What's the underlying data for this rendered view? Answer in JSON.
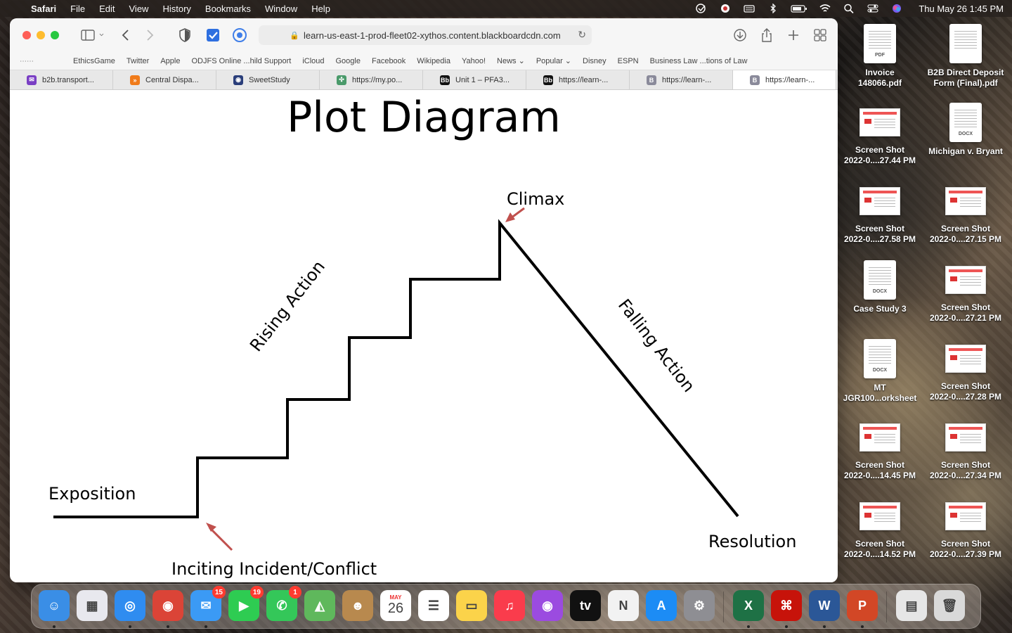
{
  "menubar": {
    "app_name": "Safari",
    "items": [
      "File",
      "Edit",
      "View",
      "History",
      "Bookmarks",
      "Window",
      "Help"
    ],
    "clock": "Thu May 26  1:45 PM"
  },
  "toolbar": {
    "url": "learn-us-east-1-prod-fleet02-xythos.content.blackboardcdn.com"
  },
  "favorites": [
    "EthicsGame",
    "Twitter",
    "Apple",
    "ODJFS Online ...hild Support",
    "iCloud",
    "Google",
    "Facebook",
    "Wikipedia",
    "Yahoo!",
    "News ⌄",
    "Popular ⌄",
    "Disney",
    "ESPN",
    "Business Law ...tions of Law"
  ],
  "tabs": [
    {
      "label": "b2b.transport...",
      "color": "#7a3fc4",
      "glyph": "✉"
    },
    {
      "label": "Central Dispa...",
      "color": "#f07b1a",
      "glyph": "»"
    },
    {
      "label": "SweetStudy",
      "color": "#2a3e7a",
      "glyph": "◉"
    },
    {
      "label": "https://my.po...",
      "color": "#4a9a6a",
      "glyph": "✣"
    },
    {
      "label": "Unit 1 – PFA3...",
      "color": "#111111",
      "glyph": "Bb"
    },
    {
      "label": "https://learn-...",
      "color": "#111111",
      "glyph": "Bb"
    },
    {
      "label": "https://learn-...",
      "color": "#8a8a9a",
      "glyph": "B"
    },
    {
      "label": "https://learn-...",
      "color": "#8a8a9a",
      "glyph": "B"
    }
  ],
  "diagram": {
    "title": "Plot Diagram",
    "labels": {
      "exposition": "Exposition",
      "inciting": "Inciting Incident/Conflict",
      "rising": "Rising Action",
      "climax": "Climax",
      "falling": "Falling Action",
      "resolution": "Resolution"
    },
    "arrow_color": "#c0504d"
  },
  "desktop": [
    {
      "kind": "doc",
      "tag": "PDF",
      "line1": "Invoice",
      "line2": "148066.pdf"
    },
    {
      "kind": "doc",
      "tag": "",
      "line1": "B2B Direct Deposit",
      "line2": "Form (Final).pdf"
    },
    {
      "kind": "shot",
      "line1": "Screen Shot",
      "line2": "2022-0....27.44 PM"
    },
    {
      "kind": "doc",
      "tag": "DOCX",
      "line1": "Michigan v. Bryant",
      "line2": ""
    },
    {
      "kind": "shot",
      "line1": "Screen Shot",
      "line2": "2022-0....27.58 PM"
    },
    {
      "kind": "shot",
      "line1": "Screen Shot",
      "line2": "2022-0....27.15 PM"
    },
    {
      "kind": "doc",
      "tag": "DOCX",
      "line1": "Case Study 3",
      "line2": ""
    },
    {
      "kind": "shot",
      "line1": "Screen Shot",
      "line2": "2022-0....27.21 PM"
    },
    {
      "kind": "doc",
      "tag": "DOCX",
      "line1": "MT",
      "line2": "JGR100...orksheet"
    },
    {
      "kind": "shot",
      "line1": "Screen Shot",
      "line2": "2022-0....27.28 PM"
    },
    {
      "kind": "shot",
      "line1": "Screen Shot",
      "line2": "2022-0....14.45 PM"
    },
    {
      "kind": "shot",
      "line1": "Screen Shot",
      "line2": "2022-0....27.34 PM"
    },
    {
      "kind": "shot",
      "line1": "Screen Shot",
      "line2": "2022-0....14.52 PM"
    },
    {
      "kind": "shot",
      "line1": "Screen Shot",
      "line2": "2022-0....27.39 PM"
    }
  ],
  "dock": {
    "apps": [
      {
        "name": "finder-icon",
        "color": "#3a8ee6",
        "glyph": "☺"
      },
      {
        "name": "launchpad-icon",
        "color": "#e8e8ee",
        "glyph": "▦"
      },
      {
        "name": "safari-icon",
        "color": "#2f8cf0",
        "glyph": "◎"
      },
      {
        "name": "chrome-icon",
        "color": "#db4437",
        "glyph": "◉"
      },
      {
        "name": "mail-icon",
        "color": "#3b9af5",
        "glyph": "✉",
        "badge": "15"
      },
      {
        "name": "facetime-icon",
        "color": "#2ecc52",
        "glyph": "▶",
        "badge": "19"
      },
      {
        "name": "messages-icon",
        "color": "#34c759",
        "glyph": "✆",
        "badge": "1"
      },
      {
        "name": "maps-icon",
        "color": "#5fb85c",
        "glyph": "◭"
      },
      {
        "name": "contacts-icon",
        "color": "#b8894e",
        "glyph": "☻"
      },
      {
        "name": "calendar-icon",
        "color": "#ffffff",
        "glyph": "26",
        "month": "MAY"
      },
      {
        "name": "reminders-icon",
        "color": "#ffffff",
        "glyph": "☰"
      },
      {
        "name": "notes-icon",
        "color": "#fbd34a",
        "glyph": "▭"
      },
      {
        "name": "music-icon",
        "color": "#fa3c4c",
        "glyph": "♫"
      },
      {
        "name": "podcasts-icon",
        "color": "#9b4be0",
        "glyph": "◉"
      },
      {
        "name": "appletv-icon",
        "color": "#111111",
        "glyph": "tv"
      },
      {
        "name": "news-icon",
        "color": "#f2f2f2",
        "glyph": "N"
      },
      {
        "name": "appstore-icon",
        "color": "#1c8cf5",
        "glyph": "A"
      },
      {
        "name": "system-preferences-icon",
        "color": "#8e8e93",
        "glyph": "⚙"
      },
      {
        "name": "excel-icon",
        "color": "#1e7145",
        "glyph": "X"
      },
      {
        "name": "acrobat-icon",
        "color": "#c7130a",
        "glyph": "⌘"
      },
      {
        "name": "word-icon",
        "color": "#2b5797",
        "glyph": "W"
      },
      {
        "name": "powerpoint-icon",
        "color": "#d24726",
        "glyph": "P"
      },
      {
        "name": "downloads-stack-icon",
        "color": "#e6e6e6",
        "glyph": "▤"
      },
      {
        "name": "trash-icon",
        "color": "#d9d9d9",
        "glyph": "🗑"
      }
    ]
  }
}
